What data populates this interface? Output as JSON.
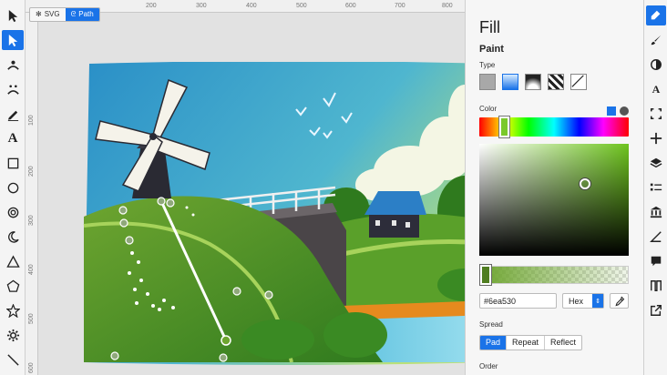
{
  "mode_switch": {
    "svg_label": "SVG",
    "path_label": "Path"
  },
  "ruler": {
    "top_ticks": [
      "200",
      "300",
      "400",
      "500",
      "600",
      "700",
      "800"
    ],
    "left_ticks": [
      "100",
      "200",
      "300",
      "400",
      "500",
      "600"
    ]
  },
  "left_toolbar": {
    "icons": [
      "pointer-icon",
      "node-select-icon",
      "tweak-icon",
      "spray-icon",
      "pencil-icon",
      "text-icon",
      "rectangle-icon",
      "ellipse-icon",
      "spiral-icon",
      "crescent-icon",
      "triangle-icon",
      "pentagon-icon",
      "star-icon",
      "gear-icon",
      "line-icon"
    ],
    "text_tool_label": "A"
  },
  "fill_panel": {
    "title": "Fill",
    "paint_label": "Paint",
    "type_label": "Type",
    "color_label": "Color",
    "hex_value": "#6ea530",
    "format_value": "Hex",
    "spread_label": "Spread",
    "spread_options": [
      "Pad",
      "Repeat",
      "Reflect"
    ],
    "order_label": "Order"
  },
  "right_toolbar": {
    "icons": [
      "fill-icon",
      "brush-icon",
      "contrast-icon",
      "font-icon",
      "crop-icon",
      "move-icon",
      "layers-icon",
      "list-icon",
      "museum-icon",
      "angle-icon",
      "comment-icon",
      "pattern-icon",
      "export-icon"
    ],
    "font_tool_label": "A"
  },
  "colors": {
    "accent": "#1a73e8",
    "fill_color": "#6ea530"
  }
}
